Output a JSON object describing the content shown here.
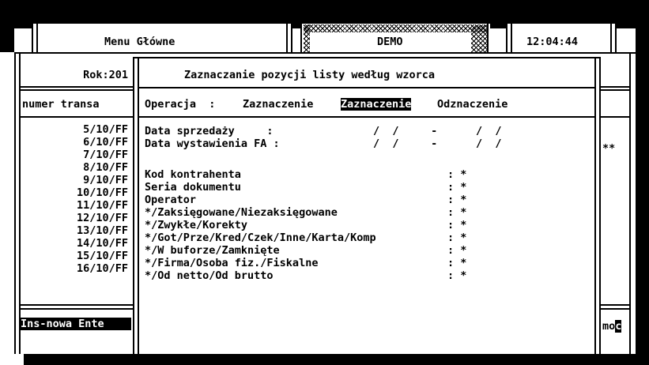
{
  "top_bar": {
    "menu_title": "Menu Główne",
    "mode_label": "DEMO",
    "clock": "12:04:44"
  },
  "background_window": {
    "year_label": "Rok:201",
    "column_header": "numer transa",
    "rows": [
      "5/10/FF",
      "6/10/FF",
      "7/10/FF",
      "8/10/FF",
      "9/10/FF",
      "10/10/FF",
      "11/10/FF",
      "12/10/FF",
      "13/10/FF",
      "14/10/FF",
      "15/10/FF",
      "16/10/FF"
    ],
    "right_marker": "**",
    "status_left": "Ins-nowa Ente",
    "status_right_prefix": "mo",
    "status_right_cursor": "c"
  },
  "dialog": {
    "title": "Zaznaczanie pozycji listy według wzorca",
    "operation_label": "Operacja  :",
    "operation_options": [
      "Zaznaczenie",
      "Zaznaczenie",
      "Odznaczenie"
    ],
    "sale_date_label": "Data sprzedaży     :",
    "sale_date_value": "/  /     -      /  /",
    "issue_date_label": "Data wystawienia FA :",
    "issue_date_value": "/  /     -      /  /",
    "filters": [
      {
        "label": "Kod kontrahenta",
        "value": ": *"
      },
      {
        "label": "Seria dokumentu",
        "value": ": *"
      },
      {
        "label": "Operator",
        "value": ": *"
      },
      {
        "label": "*/Zaksięgowane/Niezaksięgowane",
        "value": ": *"
      },
      {
        "label": "*/Zwykłe/Korekty",
        "value": ": *"
      },
      {
        "label": "*/Got/Prze/Kred/Czek/Inne/Karta/Komp",
        "value": ": *"
      },
      {
        "label": "*/W buforze/Zamknięte",
        "value": ": *"
      },
      {
        "label": "*/Firma/Osoba fiz./Fiskalne",
        "value": ": *"
      },
      {
        "label": "*/Od netto/Od brutto",
        "value": ": *"
      }
    ]
  }
}
